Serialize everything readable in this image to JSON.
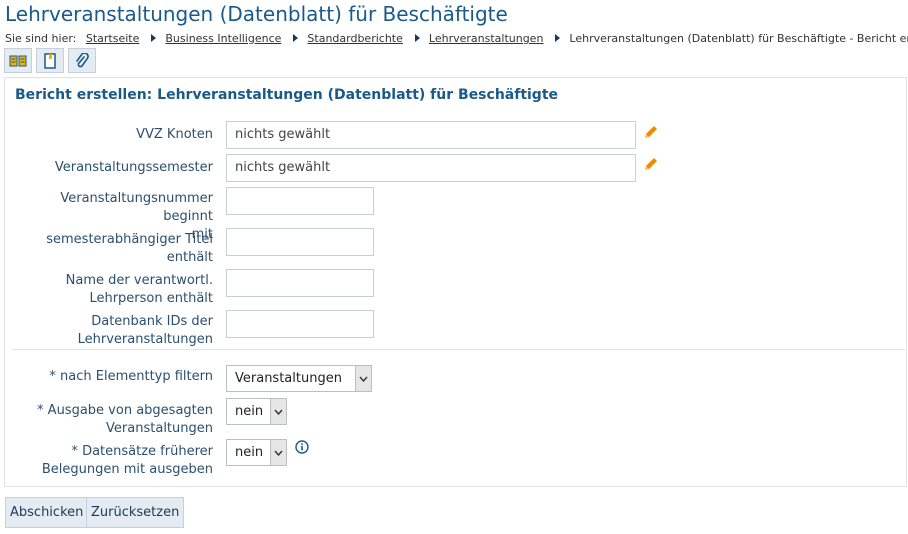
{
  "page": {
    "title": "Lehrveranstaltungen (Datenblatt) für Beschäftigte"
  },
  "breadcrumb": {
    "label": "Sie sind hier:",
    "items": [
      "Startseite",
      "Business Intelligence",
      "Standardberichte",
      "Lehrveranstaltungen"
    ],
    "current": "Lehrveranstaltungen (Datenblatt) für Beschäftigte - Bericht erstellen"
  },
  "toolbar": {
    "icons": [
      "report-icon",
      "notebook-icon",
      "paperclip-icon"
    ]
  },
  "form": {
    "title": "Bericht erstellen: Lehrveranstaltungen (Datenblatt) für Beschäftigte",
    "vvz": {
      "label": "VVZ Knoten",
      "value": "nichts gewählt"
    },
    "semester": {
      "label": "Veranstaltungssemester",
      "value": "nichts gewählt"
    },
    "nummer": {
      "label1": "Veranstaltungsnummer beginnt",
      "label2": "mit",
      "value": ""
    },
    "titel": {
      "label1": "semesterabhängiger Titel",
      "label2": "enthält",
      "value": ""
    },
    "lehrperson": {
      "label1": "Name der verantwortl.",
      "label2": "Lehrperson enthält",
      "value": ""
    },
    "ids": {
      "label1": "Datenbank IDs der",
      "label2": "Lehrveranstaltungen",
      "value": ""
    },
    "elementtyp": {
      "label": "* nach Elementtyp filtern",
      "value": "Veranstaltungen"
    },
    "abgesagt": {
      "label1": "* Ausgabe von abgesagten",
      "label2": "Veranstaltungen",
      "value": "nein"
    },
    "frueher": {
      "label1": "* Datensätze früherer",
      "label2": "Belegungen mit ausgeben",
      "value": "nein"
    }
  },
  "buttons": {
    "submit": "Abschicken",
    "reset": "Zurücksetzen"
  },
  "colors": {
    "accent": "#1a5a8a",
    "pencil": "#f08a00",
    "info": "#1a5a8a"
  }
}
